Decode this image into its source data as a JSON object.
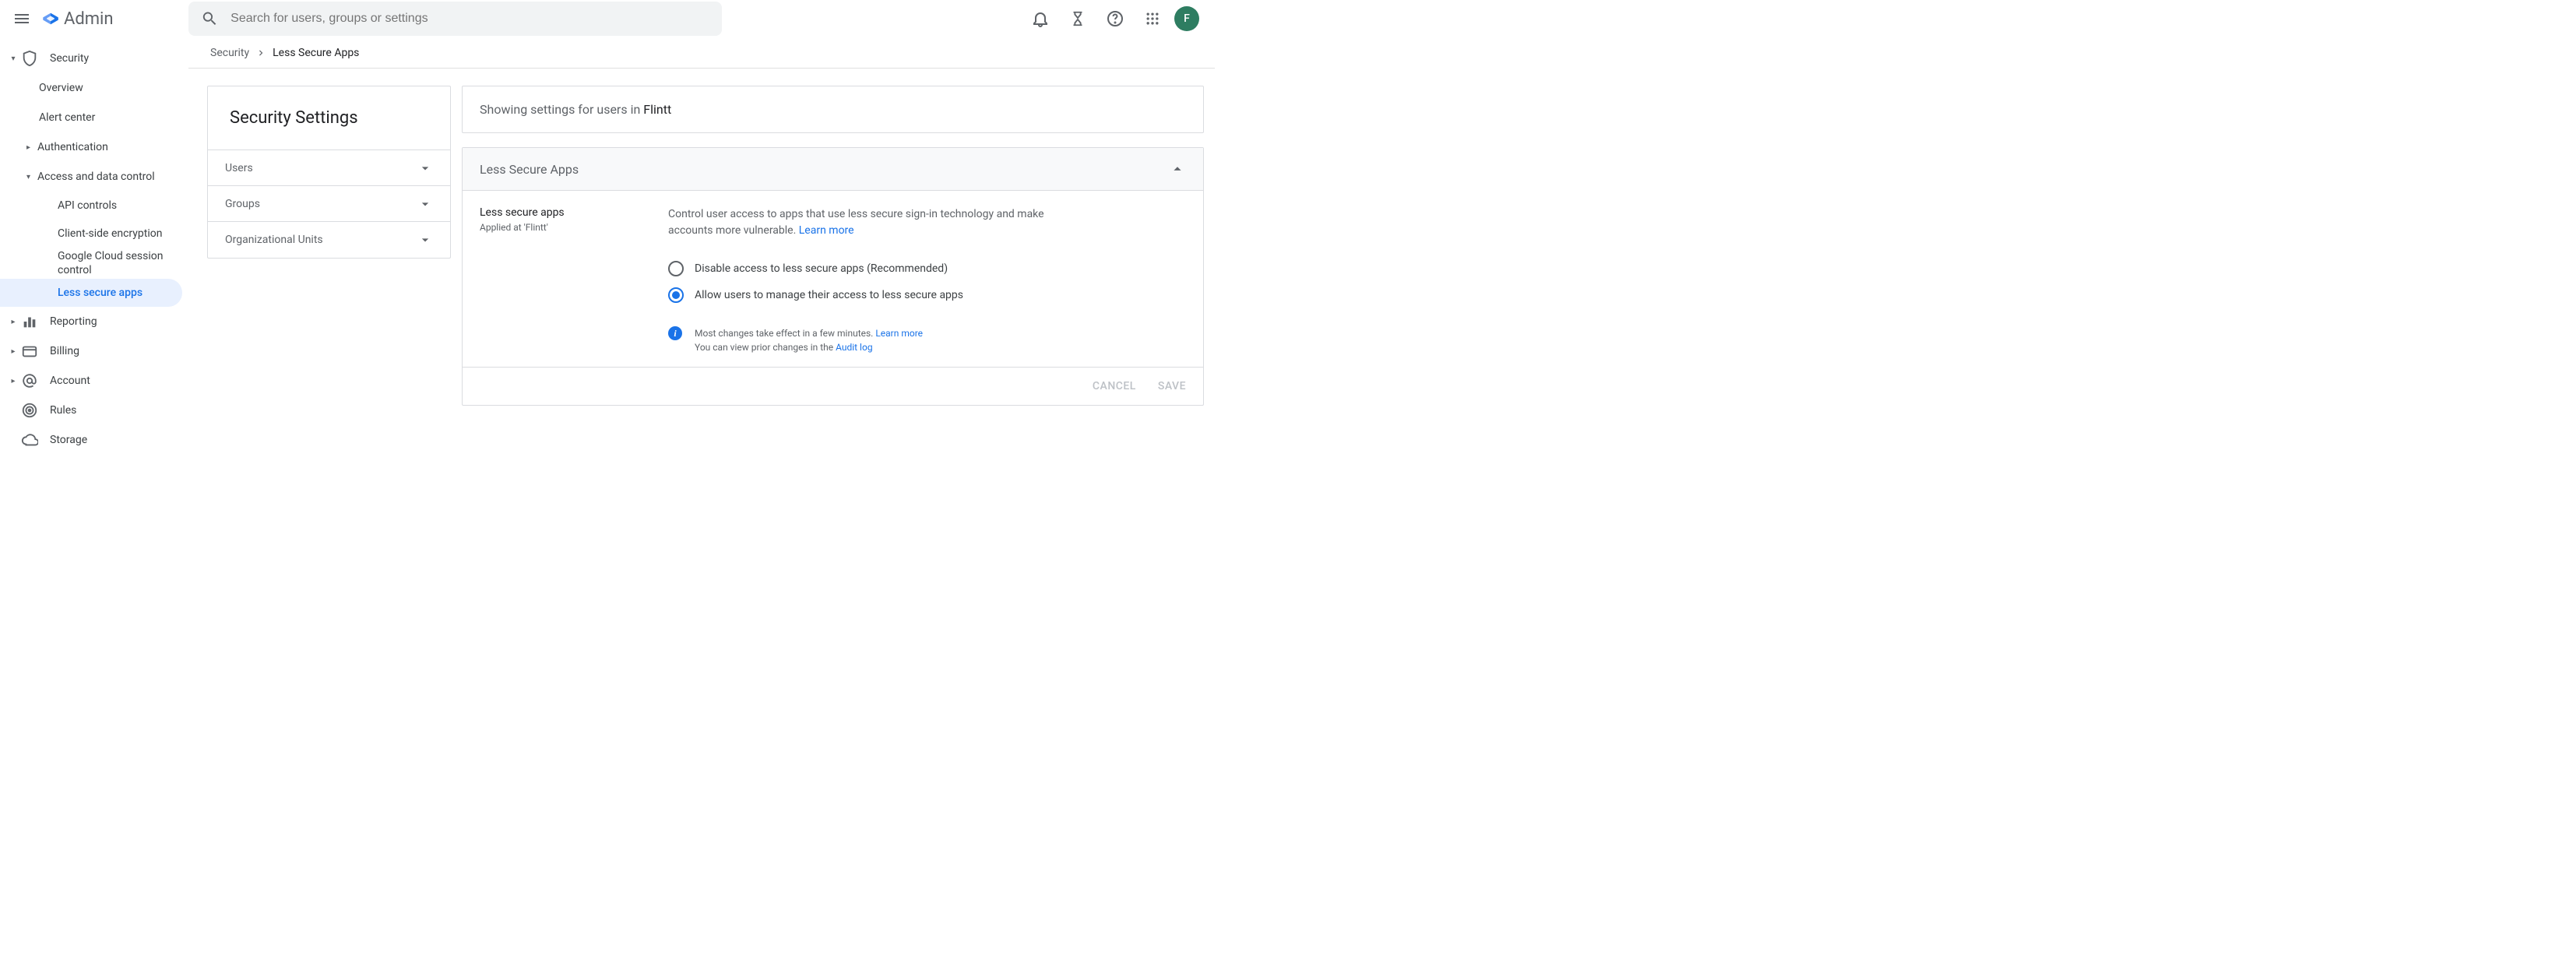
{
  "header": {
    "brand": "Admin",
    "search_placeholder": "Search for users, groups or settings",
    "avatar_initial": "F"
  },
  "sidebar": {
    "security": "Security",
    "overview": "Overview",
    "alert_center": "Alert center",
    "authentication": "Authentication",
    "access_data_control": "Access and data control",
    "api_controls": "API controls",
    "client_side_encryption": "Client-side encryption",
    "gcloud_session": "Google Cloud session control",
    "less_secure_apps": "Less secure apps",
    "reporting": "Reporting",
    "billing": "Billing",
    "account": "Account",
    "rules": "Rules",
    "storage": "Storage"
  },
  "breadcrumb": {
    "root": "Security",
    "current": "Less Secure Apps"
  },
  "left_panel": {
    "title": "Security Settings",
    "users": "Users",
    "groups": "Groups",
    "org_units": "Organizational Units"
  },
  "showing": {
    "prefix": "Showing settings for users in ",
    "org": "Flintt"
  },
  "lsa": {
    "card_title": "Less Secure Apps",
    "subtitle": "Less secure apps",
    "applied_at": "Applied at 'Flintt'",
    "description": "Control user access to apps that use less secure sign-in technology and make accounts more vulnerable. ",
    "learn_more": "Learn more",
    "option_disable": "Disable access to less secure apps (Recommended)",
    "option_allow": "Allow users to manage their access to less secure apps",
    "info1_prefix": "Most changes take effect in a few minutes. ",
    "info1_link": "Learn more",
    "info2_prefix": "You can view prior changes in the ",
    "info2_link": "Audit log"
  },
  "footer": {
    "cancel": "CANCEL",
    "save": "SAVE"
  }
}
